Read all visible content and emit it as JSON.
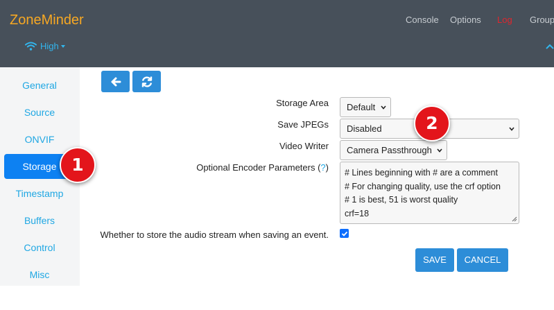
{
  "header": {
    "brand": "ZoneMinder",
    "bandwidth": "High",
    "nav": [
      "Console",
      "Options",
      "Log",
      "Group"
    ]
  },
  "sidebar": {
    "items": [
      "General",
      "Source",
      "ONVIF",
      "Storage",
      "Timestamp",
      "Buffers",
      "Control",
      "Misc"
    ],
    "active": "Storage"
  },
  "toolbar": {
    "back_icon": "arrow-left-icon",
    "refresh_icon": "refresh-icon"
  },
  "form": {
    "storage_area": {
      "label": "Storage Area",
      "value": "Default"
    },
    "save_jpegs": {
      "label": "Save JPEGs",
      "value": "Disabled"
    },
    "video_writer": {
      "label": "Video Writer",
      "value": "Camera Passthrough"
    },
    "encoder_params": {
      "label": "Optional Encoder Parameters (",
      "help": "?",
      "label_end": ")",
      "lines": [
        "# Lines beginning with # are a comment",
        "# For changing quality, use the crf option",
        "# 1 is best, 51 is worst quality",
        "crf=18"
      ]
    },
    "record_audio": {
      "label": "Whether to store the audio stream when saving an event.",
      "checked": true
    }
  },
  "actions": {
    "save": "SAVE",
    "cancel": "CANCEL"
  },
  "callouts": [
    "1",
    "2"
  ],
  "colors": {
    "brand": "#f7a823",
    "accent": "#1fa7e3",
    "active": "#0d81f2",
    "button": "#2d8dd8",
    "log": "#e0262d",
    "callout": "#e3151b"
  }
}
